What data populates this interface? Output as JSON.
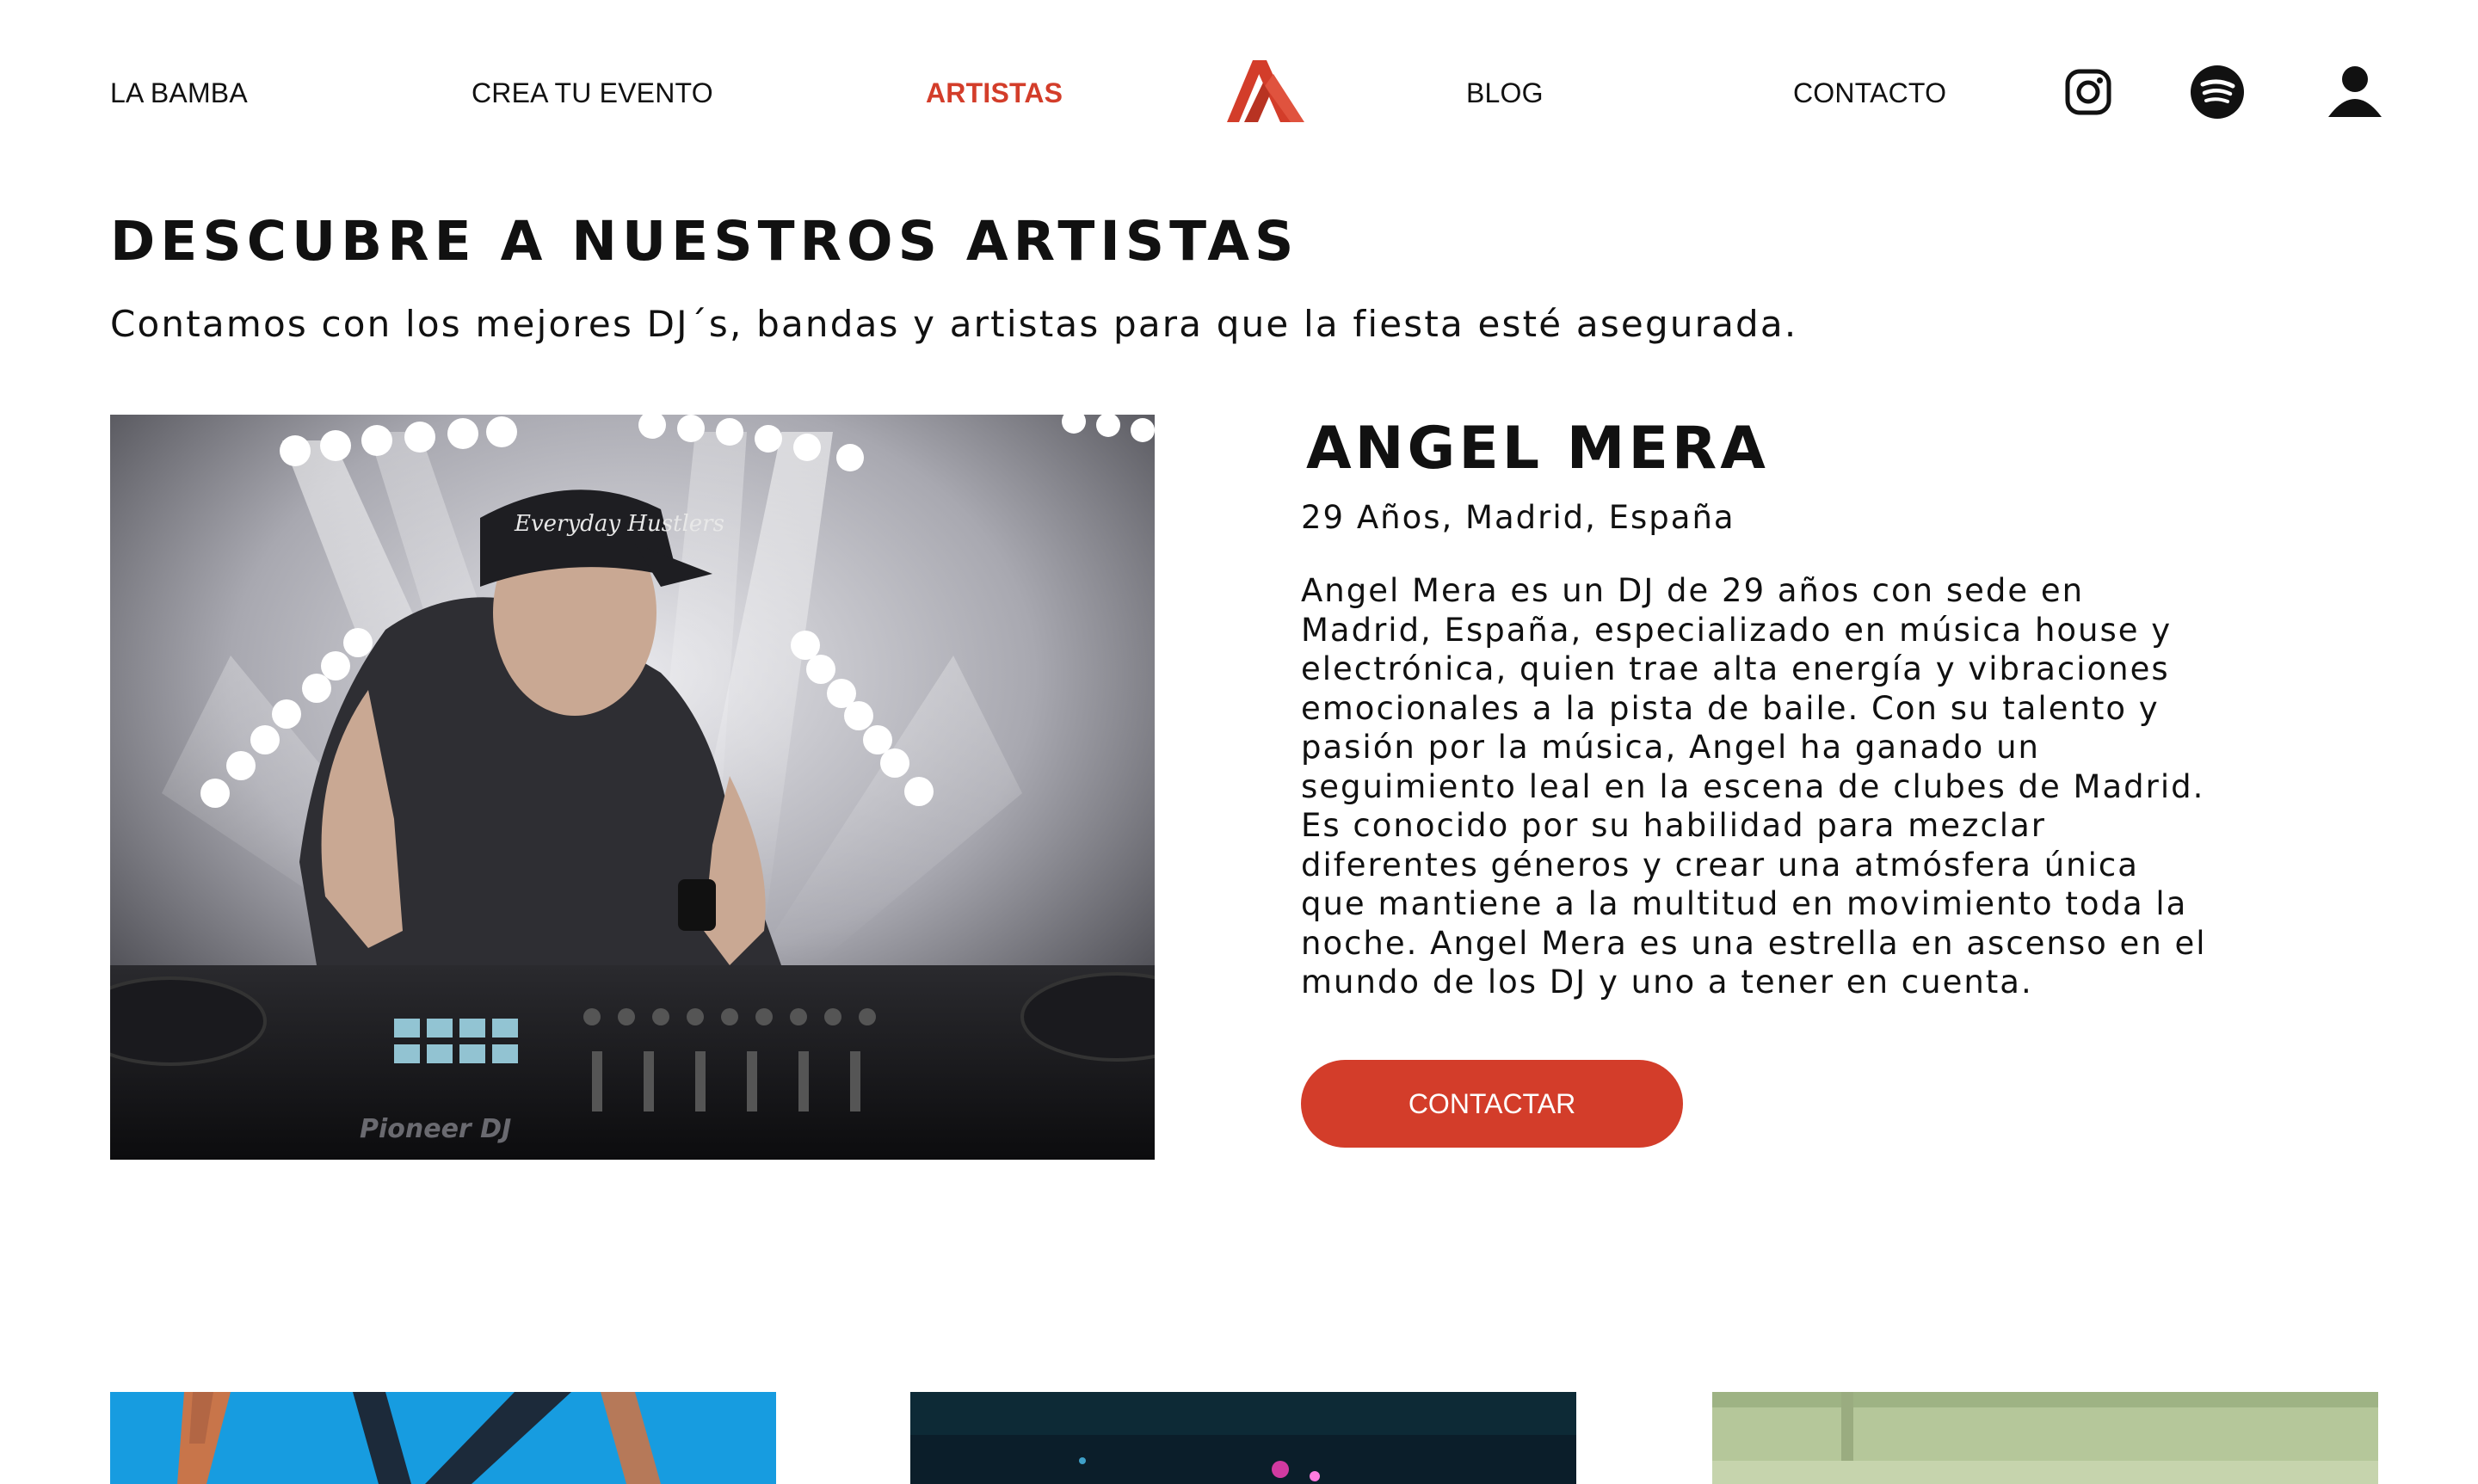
{
  "nav": {
    "items": [
      {
        "label": "LA BAMBA"
      },
      {
        "label": "CREA TU EVENTO"
      },
      {
        "label": "ARTISTAS"
      },
      {
        "label": "BLOG"
      },
      {
        "label": "CONTACTO"
      }
    ],
    "active": "ARTISTAS",
    "icons": [
      "instagram-icon",
      "spotify-icon",
      "user-icon"
    ],
    "logo": "la-bamba-logo"
  },
  "hero": {
    "title": "DESCUBRE A NUESTROS ARTISTAS",
    "subtitle": "Contamos con los mejores DJ´s, bandas y artistas para que la fiesta esté asegurada."
  },
  "featured": {
    "photo_text": {
      "cap": "Everyday Hustlers",
      "brand": "Pioneer DJ"
    },
    "name": "ANGEL MERA",
    "meta": "29 Años, Madrid, España",
    "bio": "Angel Mera es un DJ de 29 años con sede en Madrid, España, especializado en música house y electrónica, quien trae alta energía y vibraciones emocionales a la pista de baile. Con su talento y pasión por la música, Angel ha ganado un seguimiento leal en la escena de clubes de Madrid. Es conocido por su habilidad para mezclar diferentes géneros y crear una atmósfera única que mantiene a la multitud en movimiento toda la noche. Angel Mera es una estrella en ascenso en el mundo de los DJ y uno a tener en cuenta.",
    "button": "CONTACTAR"
  },
  "colors": {
    "accent": "#d33d2a",
    "text": "#111111",
    "background": "#ffffff"
  }
}
